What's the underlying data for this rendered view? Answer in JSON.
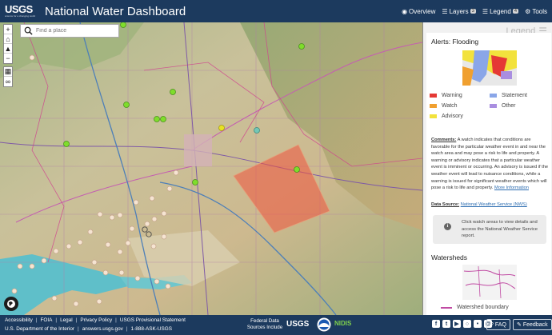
{
  "header": {
    "logo_main": "USGS",
    "logo_tagline": "science for a changing world",
    "title": "National Water Dashboard",
    "nav": [
      {
        "label": "Overview",
        "icon": "eye-icon"
      },
      {
        "label": "Layers",
        "icon": "layers-icon",
        "badge": "3"
      },
      {
        "label": "Legend",
        "icon": "legend-list-icon",
        "badge": "4"
      },
      {
        "label": "Tools",
        "icon": "gear-icon"
      }
    ]
  },
  "map": {
    "search_placeholder": "Find a place",
    "zoom_controls": [
      "+",
      "home",
      "locate",
      "−"
    ],
    "tool_controls": [
      "basemap",
      "link"
    ]
  },
  "legend_panel": {
    "heading": "Legend",
    "alerts": {
      "title": "Alerts: Flooding",
      "items": [
        {
          "label": "Warning",
          "color": "#e53935"
        },
        {
          "label": "Statement",
          "color": "#8aa6e8"
        },
        {
          "label": "Watch",
          "color": "#f0a030"
        },
        {
          "label": "Other",
          "color": "#a98ee0"
        },
        {
          "label": "Advisory",
          "color": "#f2e23d"
        }
      ],
      "comments_label": "Comments:",
      "comments_text": "A watch indicates that conditions are favorable for the particular weather event in and near the watch area and may pose a risk to life and property. A warning or advisory indicates that a particular weather event is imminent or occurring. An advisory is issued if the weather event will lead to nuisance conditions, while a warning is issued for significant weather events which will pose a risk to life and property.",
      "more_link": "More Information",
      "data_source_label": "Data Source:",
      "data_source_link": "National Weather Service (NWS)",
      "info_text": "Click watch areas to view details and access the National Weather Service report."
    },
    "watersheds": {
      "title": "Watersheds",
      "legend_label": "Watershed boundary"
    }
  },
  "footer": {
    "links": [
      "Accessibility",
      "FOIA",
      "Legal",
      "Privacy Policy",
      "USGS Provisional Statement"
    ],
    "links2": [
      "U.S. Department of the Interior",
      "answers.usgs.gov",
      "1-888-ASK-USGS"
    ],
    "federal_label": "Federal Data Sources Include",
    "partner_logos": [
      "USGS",
      "NOAA",
      "NIDIS"
    ],
    "faq_label": "FAQ",
    "feedback_label": "Feedback",
    "social": [
      "facebook",
      "twitter",
      "youtube",
      "instagram",
      "flickr",
      "email"
    ]
  }
}
